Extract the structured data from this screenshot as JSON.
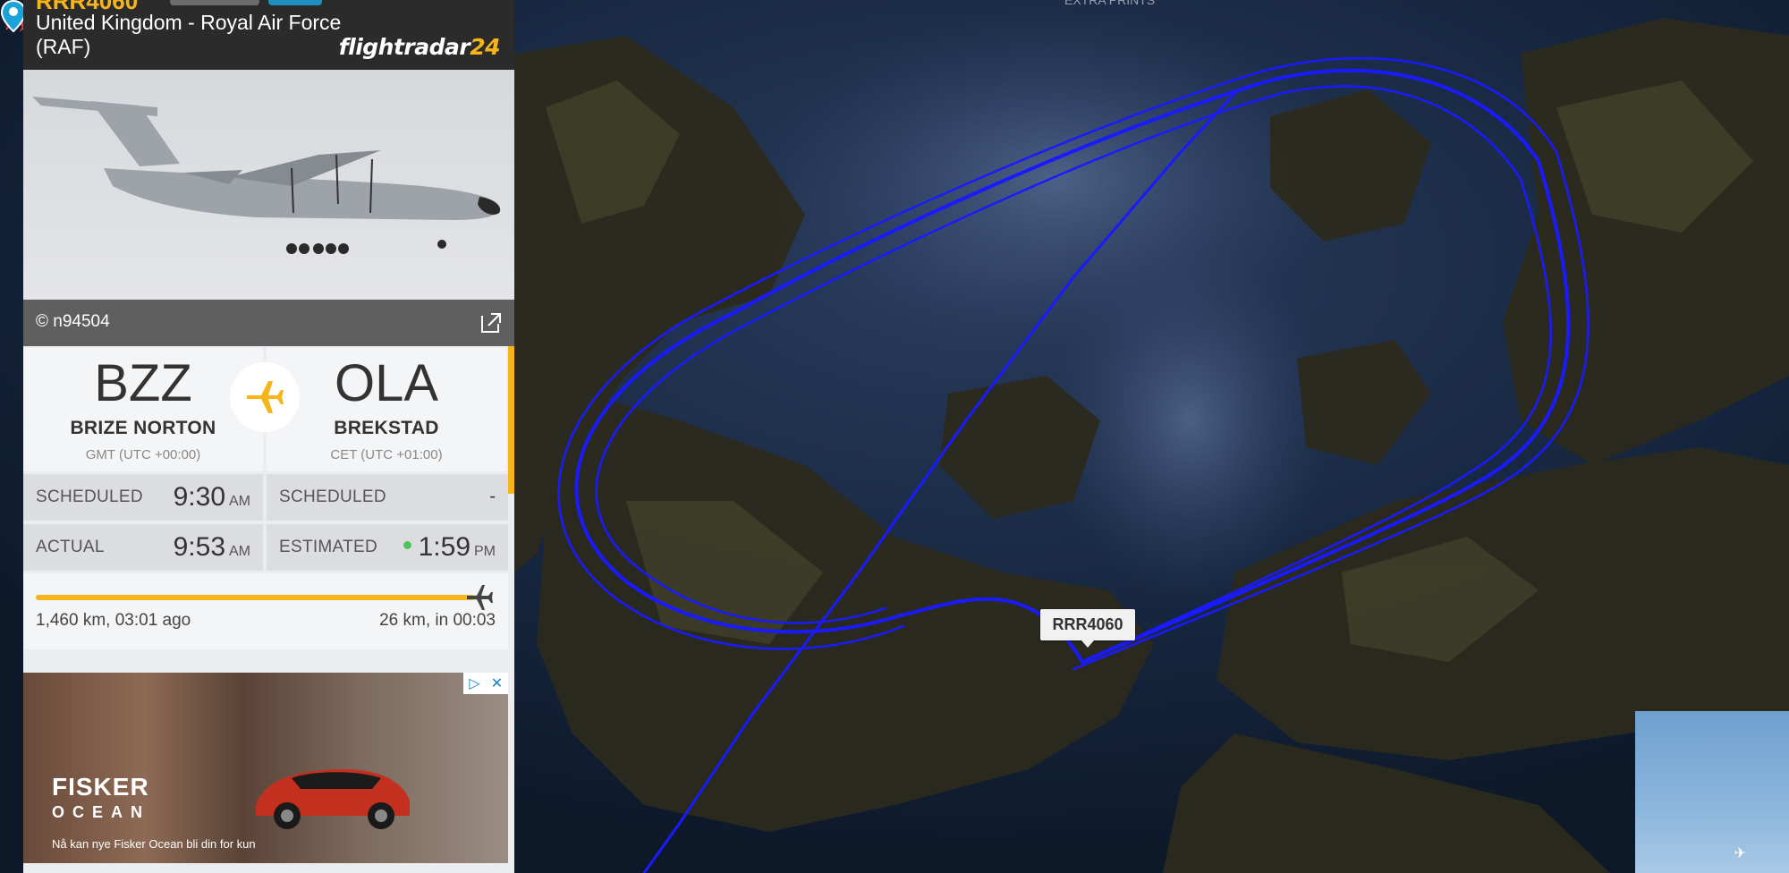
{
  "flight": {
    "callsign": "RRR4060",
    "airline": "United Kingdom - Royal Air Force (RAF)",
    "logo_main": "flightradar",
    "logo_num": "24"
  },
  "photo": {
    "credit": "© n94504"
  },
  "route": {
    "origin": {
      "iata": "BZZ",
      "city": "BRIZE NORTON",
      "timezone": "GMT (UTC +00:00)"
    },
    "destination": {
      "iata": "OLA",
      "city": "BREKSTAD",
      "timezone": "CET (UTC +01:00)"
    }
  },
  "times": {
    "origin_scheduled_label": "SCHEDULED",
    "origin_scheduled_time": "9:30",
    "origin_scheduled_ampm": "AM",
    "origin_actual_label": "ACTUAL",
    "origin_actual_time": "9:53",
    "origin_actual_ampm": "AM",
    "dest_scheduled_label": "SCHEDULED",
    "dest_scheduled_time": "-",
    "dest_estimated_label": "ESTIMATED",
    "dest_estimated_time": "1:59",
    "dest_estimated_ampm": "PM"
  },
  "progress": {
    "fraction": 0.98,
    "flown": "1,460 km, 03:01 ago",
    "remaining": "26 km, in 00:03"
  },
  "ad": {
    "brand": "FISKER",
    "sub": "OCEAN",
    "tagline": "Nå kan nye Fisker Ocean bli din for kun"
  },
  "map": {
    "aircraft_label": "RRR4060",
    "track_color": "#1a1aff",
    "aircraft_color": "#e03a3a"
  },
  "icons": [
    "external-link-icon",
    "airplane-icon",
    "location-pin-icon",
    "ad-choices-icon",
    "close-icon"
  ]
}
